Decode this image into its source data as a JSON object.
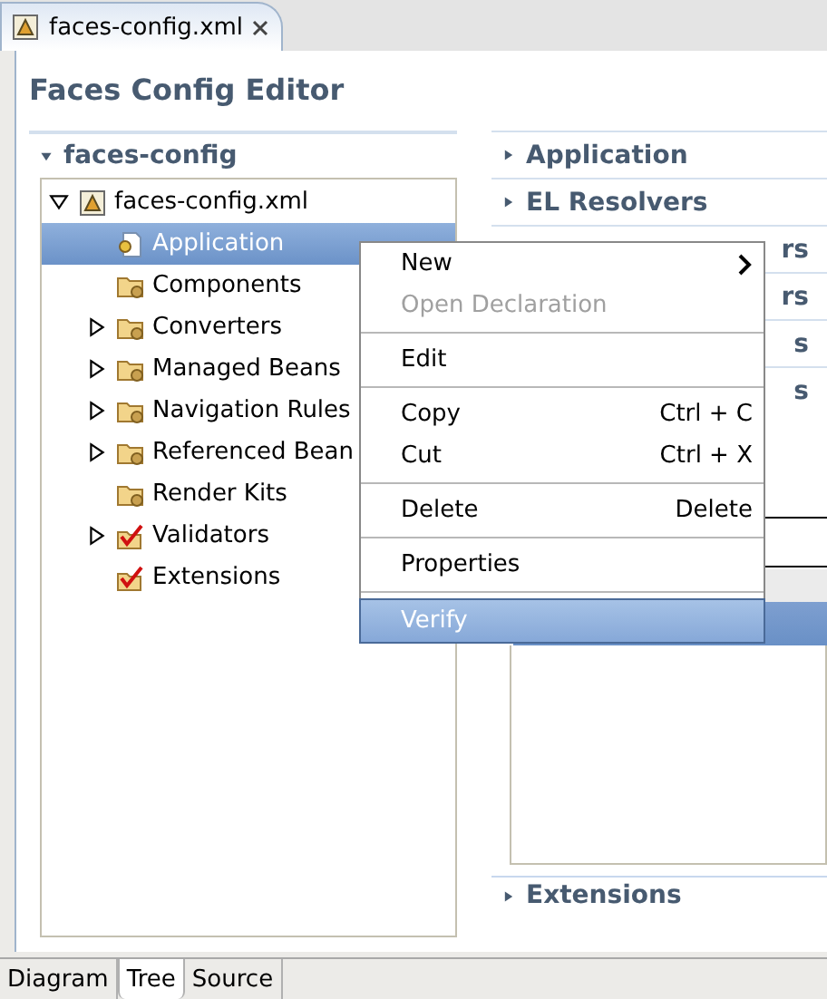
{
  "editor_tab": {
    "label": "faces-config.xml"
  },
  "title": "Faces Config Editor",
  "tree_section": {
    "title": "faces-config",
    "expanded": true
  },
  "tree": [
    {
      "label": "faces-config.xml",
      "kind": "file",
      "expanded": true,
      "selected": false,
      "children": [
        {
          "label": "Application",
          "kind": "app",
          "selected": true
        },
        {
          "label": "Components",
          "kind": "folder",
          "selected": false
        },
        {
          "label": "Converters",
          "kind": "folder",
          "expanded": false,
          "selected": false
        },
        {
          "label": "Managed Beans",
          "kind": "folder",
          "expanded": false,
          "selected": false
        },
        {
          "label": "Navigation Rules",
          "kind": "folder",
          "expanded": false,
          "selected": false
        },
        {
          "label": "Referenced Bean",
          "kind": "folder",
          "expanded": false,
          "selected": false
        },
        {
          "label": "Render Kits",
          "kind": "folder",
          "selected": false
        },
        {
          "label": "Validators",
          "kind": "check",
          "expanded": false,
          "selected": false
        },
        {
          "label": "Extensions",
          "kind": "check",
          "selected": false
        }
      ]
    }
  ],
  "sections": [
    {
      "title": "Application",
      "kind": "header"
    },
    {
      "title": "EL Resolvers",
      "kind": "header"
    },
    {
      "title": "rs",
      "kind": "covered"
    },
    {
      "title": "rs",
      "kind": "covered"
    },
    {
      "title": "s",
      "kind": "covered"
    },
    {
      "title": "s",
      "kind": "covered"
    }
  ],
  "bottom_section": {
    "title": "Extensions"
  },
  "context_menu": [
    [
      {
        "label": "New",
        "submenu": true,
        "disabled": false,
        "selected": false
      },
      {
        "label": "Open Declaration",
        "disabled": true,
        "selected": false
      }
    ],
    [
      {
        "label": "Edit",
        "disabled": false,
        "selected": false
      }
    ],
    [
      {
        "label": "Copy",
        "shortcut": "Ctrl + C",
        "disabled": false,
        "selected": false
      },
      {
        "label": "Cut",
        "shortcut": "Ctrl + X",
        "disabled": false,
        "selected": false
      }
    ],
    [
      {
        "label": "Delete",
        "shortcut": "Delete",
        "disabled": false,
        "selected": false
      }
    ],
    [
      {
        "label": "Properties",
        "disabled": false,
        "selected": false
      }
    ],
    [
      {
        "label": "Verify",
        "disabled": false,
        "selected": true
      }
    ]
  ],
  "bottom_tabs": [
    {
      "label": "Diagram",
      "selected": false
    },
    {
      "label": "Tree",
      "selected": true
    },
    {
      "label": "Source",
      "selected": false
    }
  ]
}
